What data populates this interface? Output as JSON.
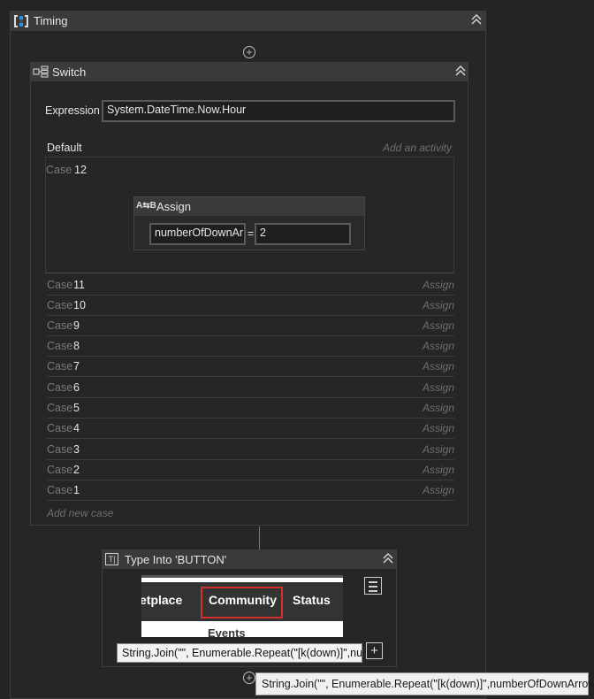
{
  "timing": {
    "title": "Timing"
  },
  "switch": {
    "title": "Switch",
    "expression_label": "Expression",
    "expression_value": "System.DateTime.Now.Hour",
    "default_label": "Default",
    "default_placeholder": "Add an activity",
    "case_label": "Case",
    "case12_value": "12",
    "assign": {
      "title": "Assign",
      "left": "numberOfDownAr",
      "eq": "=",
      "right": "2"
    },
    "cases": [
      {
        "value": "11",
        "action": "Assign"
      },
      {
        "value": "10",
        "action": "Assign"
      },
      {
        "value": "9",
        "action": "Assign"
      },
      {
        "value": "8",
        "action": "Assign"
      },
      {
        "value": "7",
        "action": "Assign"
      },
      {
        "value": "6",
        "action": "Assign"
      },
      {
        "value": "5",
        "action": "Assign"
      },
      {
        "value": "4",
        "action": "Assign"
      },
      {
        "value": "3",
        "action": "Assign"
      },
      {
        "value": "2",
        "action": "Assign"
      },
      {
        "value": "1",
        "action": "Assign"
      }
    ],
    "add_new_case": "Add new case"
  },
  "typeinto": {
    "title": "Type Into 'BUTTON'",
    "screenshot_tabs": [
      "etplace",
      "Community",
      "Status"
    ],
    "screenshot_subtext": "Events",
    "text_value": "String.Join(\"\", Enumerable.Repeat(\"[k(down)]\",numb",
    "plus_label": "+"
  },
  "tooltip": "String.Join(\"\", Enumerable.Repeat(\"[k(down)]\",numberOfDownArrow))",
  "icons": {
    "collapse": "double-chevron-up-icon",
    "add": "plus-circle-icon"
  },
  "colors": {
    "background": "#242424",
    "header": "#3a3a3a",
    "highlight_red": "#d0312d",
    "sequence_blue": "#2f8fd8"
  }
}
